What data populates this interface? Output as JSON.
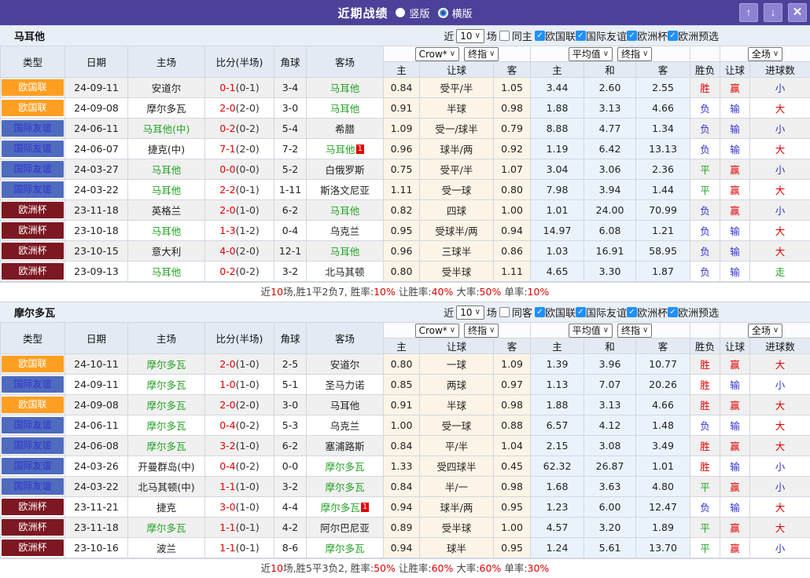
{
  "titlebar": {
    "title": "近期战绩",
    "vertical_label": "竖版",
    "horizontal_label": "横版"
  },
  "icons": {
    "check": "✓",
    "chevron": "∨",
    "up": "↑",
    "down": "↓",
    "close": "✕"
  },
  "colors": {
    "accent_purple": "#4c4199",
    "league_orange": "#ff9f22",
    "league_blue": "#4f6bbe",
    "league_maroon": "#7c1822",
    "win_red": "#e10000",
    "draw_green": "#23a223",
    "lose_blue": "#3232d0",
    "team_green": "#23a223",
    "checkbox_blue": "#1e90ff"
  },
  "table_labels": {
    "col_type": "类型",
    "col_date": "日期",
    "col_home": "主场",
    "col_score": "比分(半场)",
    "col_corner": "角球",
    "col_away": "客场",
    "sub_home": "主",
    "sub_handicap": "让球",
    "sub_away": "客",
    "sub_avg_home": "主",
    "sub_avg_draw": "和",
    "sub_avg_away": "客",
    "col_result": "胜负",
    "col_hcp_result": "让球",
    "col_goals": "进球数",
    "select_bookmaker": "Crow*",
    "select_final": "终指",
    "select_average": "平均值",
    "select_final2": "终指",
    "select_scope": "全场"
  },
  "sections": [
    {
      "team": "马耳他",
      "filter": {
        "near_label": "近",
        "count": "10",
        "games_label": "场",
        "same_label": "同主",
        "leagues": [
          "欧国联",
          "国际友谊",
          "欧洲杯",
          "欧洲预选"
        ]
      },
      "rows": [
        {
          "league": "欧国联",
          "league_color": "orange",
          "date": "24-09-11",
          "home": "安道尔",
          "home_color": "",
          "home_badge": "",
          "score": "0-1",
          "half": "(0-1)",
          "corner": "3-4",
          "away": "马耳他",
          "away_color": "green",
          "away_badge": "",
          "odds_home": "0.84",
          "handicap": "受平/半",
          "odds_away": "1.05",
          "avg_home": "3.44",
          "avg_draw": "2.60",
          "avg_away": "2.55",
          "result": "胜",
          "result_color": "red",
          "hcp_result": "赢",
          "hcp_result_color": "red",
          "goals": "小",
          "goals_color": "blue"
        },
        {
          "league": "欧国联",
          "league_color": "orange",
          "date": "24-09-08",
          "home": "摩尔多瓦",
          "home_color": "",
          "home_badge": "",
          "score": "2-0",
          "half": "(2-0)",
          "corner": "3-0",
          "away": "马耳他",
          "away_color": "green",
          "away_badge": "",
          "odds_home": "0.91",
          "handicap": "半球",
          "odds_away": "0.98",
          "avg_home": "1.88",
          "avg_draw": "3.13",
          "avg_away": "4.66",
          "result": "负",
          "result_color": "blue",
          "hcp_result": "输",
          "hcp_result_color": "blue",
          "goals": "大",
          "goals_color": "red"
        },
        {
          "league": "国际友谊",
          "league_color": "blue",
          "date": "24-06-11",
          "home": "马耳他(中)",
          "home_color": "green",
          "home_badge": "",
          "score": "0-2",
          "half": "(0-2)",
          "corner": "5-4",
          "away": "希腊",
          "away_color": "",
          "away_badge": "",
          "odds_home": "1.09",
          "handicap": "受一/球半",
          "odds_away": "0.79",
          "avg_home": "8.88",
          "avg_draw": "4.77",
          "avg_away": "1.34",
          "result": "负",
          "result_color": "blue",
          "hcp_result": "输",
          "hcp_result_color": "blue",
          "goals": "小",
          "goals_color": "blue"
        },
        {
          "league": "国际友谊",
          "league_color": "blue",
          "date": "24-06-07",
          "home": "捷克(中)",
          "home_color": "",
          "home_badge": "",
          "score": "7-1",
          "half": "(2-0)",
          "corner": "7-2",
          "away": "马耳他",
          "away_color": "green",
          "away_badge": "1",
          "odds_home": "0.96",
          "handicap": "球半/两",
          "odds_away": "0.92",
          "avg_home": "1.19",
          "avg_draw": "6.42",
          "avg_away": "13.13",
          "result": "负",
          "result_color": "blue",
          "hcp_result": "输",
          "hcp_result_color": "blue",
          "goals": "大",
          "goals_color": "red"
        },
        {
          "league": "国际友谊",
          "league_color": "blue",
          "date": "24-03-27",
          "home": "马耳他",
          "home_color": "green",
          "home_badge": "",
          "score": "0-0",
          "half": "(0-0)",
          "corner": "5-2",
          "away": "白俄罗斯",
          "away_color": "",
          "away_badge": "",
          "odds_home": "0.75",
          "handicap": "受平/半",
          "odds_away": "1.07",
          "avg_home": "3.04",
          "avg_draw": "3.06",
          "avg_away": "2.36",
          "result": "平",
          "result_color": "green",
          "hcp_result": "赢",
          "hcp_result_color": "red",
          "goals": "小",
          "goals_color": "blue"
        },
        {
          "league": "国际友谊",
          "league_color": "blue",
          "date": "24-03-22",
          "home": "马耳他",
          "home_color": "green",
          "home_badge": "",
          "score": "2-2",
          "half": "(0-1)",
          "corner": "1-11",
          "away": "斯洛文尼亚",
          "away_color": "",
          "away_badge": "",
          "odds_home": "1.11",
          "handicap": "受一球",
          "odds_away": "0.80",
          "avg_home": "7.98",
          "avg_draw": "3.94",
          "avg_away": "1.44",
          "result": "平",
          "result_color": "green",
          "hcp_result": "赢",
          "hcp_result_color": "red",
          "goals": "大",
          "goals_color": "red"
        },
        {
          "league": "欧洲杯",
          "league_color": "maroon",
          "date": "23-11-18",
          "home": "英格兰",
          "home_color": "",
          "home_badge": "",
          "score": "2-0",
          "half": "(1-0)",
          "corner": "6-2",
          "away": "马耳他",
          "away_color": "green",
          "away_badge": "",
          "odds_home": "0.82",
          "handicap": "四球",
          "odds_away": "1.00",
          "avg_home": "1.01",
          "avg_draw": "24.00",
          "avg_away": "70.99",
          "result": "负",
          "result_color": "blue",
          "hcp_result": "赢",
          "hcp_result_color": "red",
          "goals": "小",
          "goals_color": "blue"
        },
        {
          "league": "欧洲杯",
          "league_color": "maroon",
          "date": "23-10-18",
          "home": "马耳他",
          "home_color": "green",
          "home_badge": "",
          "score": "1-3",
          "half": "(1-2)",
          "corner": "0-4",
          "away": "乌克兰",
          "away_color": "",
          "away_badge": "",
          "odds_home": "0.95",
          "handicap": "受球半/两",
          "odds_away": "0.94",
          "avg_home": "14.97",
          "avg_draw": "6.08",
          "avg_away": "1.21",
          "result": "负",
          "result_color": "blue",
          "hcp_result": "输",
          "hcp_result_color": "blue",
          "goals": "大",
          "goals_color": "red"
        },
        {
          "league": "欧洲杯",
          "league_color": "maroon",
          "date": "23-10-15",
          "home": "意大利",
          "home_color": "",
          "home_badge": "",
          "score": "4-0",
          "half": "(2-0)",
          "corner": "12-1",
          "away": "马耳他",
          "away_color": "green",
          "away_badge": "",
          "odds_home": "0.96",
          "handicap": "三球半",
          "odds_away": "0.86",
          "avg_home": "1.03",
          "avg_draw": "16.91",
          "avg_away": "58.95",
          "result": "负",
          "result_color": "blue",
          "hcp_result": "输",
          "hcp_result_color": "blue",
          "goals": "大",
          "goals_color": "red"
        },
        {
          "league": "欧洲杯",
          "league_color": "maroon",
          "date": "23-09-13",
          "home": "马耳他",
          "home_color": "green",
          "home_badge": "",
          "score": "0-2",
          "half": "(0-2)",
          "corner": "3-2",
          "away": "北马其顿",
          "away_color": "",
          "away_badge": "",
          "odds_home": "0.80",
          "handicap": "受半球",
          "odds_away": "1.11",
          "avg_home": "4.65",
          "avg_draw": "3.30",
          "avg_away": "1.87",
          "result": "负",
          "result_color": "blue",
          "hcp_result": "输",
          "hcp_result_color": "blue",
          "goals": "走",
          "goals_color": "green"
        }
      ],
      "summary": [
        {
          "text": "近",
          "cls": ""
        },
        {
          "text": "10",
          "cls": "red"
        },
        {
          "text": "场,胜1平2负7, 胜率:",
          "cls": ""
        },
        {
          "text": "10%",
          "cls": "red"
        },
        {
          "text": " 让胜率:",
          "cls": ""
        },
        {
          "text": "40%",
          "cls": "red"
        },
        {
          "text": " 大率:",
          "cls": ""
        },
        {
          "text": "50%",
          "cls": "red"
        },
        {
          "text": " 单率:",
          "cls": ""
        },
        {
          "text": "10%",
          "cls": "red"
        }
      ]
    },
    {
      "team": "摩尔多瓦",
      "filter": {
        "near_label": "近",
        "count": "10",
        "games_label": "场",
        "same_label": "同客",
        "leagues": [
          "欧国联",
          "国际友谊",
          "欧洲杯",
          "欧洲预选"
        ]
      },
      "rows": [
        {
          "league": "欧国联",
          "league_color": "orange",
          "date": "24-10-11",
          "home": "摩尔多瓦",
          "home_color": "green",
          "home_badge": "",
          "score": "2-0",
          "half": "(1-0)",
          "corner": "2-5",
          "away": "安道尔",
          "away_color": "",
          "away_badge": "",
          "odds_home": "0.80",
          "handicap": "一球",
          "odds_away": "1.09",
          "avg_home": "1.39",
          "avg_draw": "3.96",
          "avg_away": "10.77",
          "result": "胜",
          "result_color": "red",
          "hcp_result": "赢",
          "hcp_result_color": "red",
          "goals": "大",
          "goals_color": "red"
        },
        {
          "league": "国际友谊",
          "league_color": "blue",
          "date": "24-09-11",
          "home": "摩尔多瓦",
          "home_color": "green",
          "home_badge": "",
          "score": "1-0",
          "half": "(1-0)",
          "corner": "5-1",
          "away": "圣马力诺",
          "away_color": "",
          "away_badge": "",
          "odds_home": "0.85",
          "handicap": "两球",
          "odds_away": "0.97",
          "avg_home": "1.13",
          "avg_draw": "7.07",
          "avg_away": "20.26",
          "result": "胜",
          "result_color": "red",
          "hcp_result": "输",
          "hcp_result_color": "blue",
          "goals": "小",
          "goals_color": "blue"
        },
        {
          "league": "欧国联",
          "league_color": "orange",
          "date": "24-09-08",
          "home": "摩尔多瓦",
          "home_color": "green",
          "home_badge": "",
          "score": "2-0",
          "half": "(2-0)",
          "corner": "3-0",
          "away": "马耳他",
          "away_color": "",
          "away_badge": "",
          "odds_home": "0.91",
          "handicap": "半球",
          "odds_away": "0.98",
          "avg_home": "1.88",
          "avg_draw": "3.13",
          "avg_away": "4.66",
          "result": "胜",
          "result_color": "red",
          "hcp_result": "赢",
          "hcp_result_color": "red",
          "goals": "大",
          "goals_color": "red"
        },
        {
          "league": "国际友谊",
          "league_color": "blue",
          "date": "24-06-11",
          "home": "摩尔多瓦",
          "home_color": "green",
          "home_badge": "",
          "score": "0-4",
          "half": "(0-2)",
          "corner": "5-3",
          "away": "乌克兰",
          "away_color": "",
          "away_badge": "",
          "odds_home": "1.00",
          "handicap": "受一球",
          "odds_away": "0.88",
          "avg_home": "6.57",
          "avg_draw": "4.12",
          "avg_away": "1.48",
          "result": "负",
          "result_color": "blue",
          "hcp_result": "输",
          "hcp_result_color": "blue",
          "goals": "大",
          "goals_color": "red"
        },
        {
          "league": "国际友谊",
          "league_color": "blue",
          "date": "24-06-08",
          "home": "摩尔多瓦",
          "home_color": "green",
          "home_badge": "",
          "score": "3-2",
          "half": "(1-0)",
          "corner": "6-2",
          "away": "塞浦路斯",
          "away_color": "",
          "away_badge": "",
          "odds_home": "0.84",
          "handicap": "平/半",
          "odds_away": "1.04",
          "avg_home": "2.15",
          "avg_draw": "3.08",
          "avg_away": "3.49",
          "result": "胜",
          "result_color": "red",
          "hcp_result": "赢",
          "hcp_result_color": "red",
          "goals": "大",
          "goals_color": "red"
        },
        {
          "league": "国际友谊",
          "league_color": "blue",
          "date": "24-03-26",
          "home": "开曼群岛(中)",
          "home_color": "",
          "home_badge": "",
          "score": "0-4",
          "half": "(0-2)",
          "corner": "0-0",
          "away": "摩尔多瓦",
          "away_color": "green",
          "away_badge": "",
          "odds_home": "1.33",
          "handicap": "受四球半",
          "odds_away": "0.45",
          "avg_home": "62.32",
          "avg_draw": "26.87",
          "avg_away": "1.01",
          "result": "胜",
          "result_color": "red",
          "hcp_result": "输",
          "hcp_result_color": "blue",
          "goals": "小",
          "goals_color": "blue"
        },
        {
          "league": "国际友谊",
          "league_color": "blue",
          "date": "24-03-22",
          "home": "北马其顿(中)",
          "home_color": "",
          "home_badge": "",
          "score": "1-1",
          "half": "(1-0)",
          "corner": "3-2",
          "away": "摩尔多瓦",
          "away_color": "green",
          "away_badge": "",
          "odds_home": "0.84",
          "handicap": "半/一",
          "odds_away": "0.98",
          "avg_home": "1.68",
          "avg_draw": "3.63",
          "avg_away": "4.80",
          "result": "平",
          "result_color": "green",
          "hcp_result": "赢",
          "hcp_result_color": "red",
          "goals": "小",
          "goals_color": "blue"
        },
        {
          "league": "欧洲杯",
          "league_color": "maroon",
          "date": "23-11-21",
          "home": "捷克",
          "home_color": "",
          "home_badge": "",
          "score": "3-0",
          "half": "(1-0)",
          "corner": "4-4",
          "away": "摩尔多瓦",
          "away_color": "green",
          "away_badge": "1",
          "odds_home": "0.94",
          "handicap": "球半/两",
          "odds_away": "0.95",
          "avg_home": "1.23",
          "avg_draw": "6.00",
          "avg_away": "12.47",
          "result": "负",
          "result_color": "blue",
          "hcp_result": "输",
          "hcp_result_color": "blue",
          "goals": "大",
          "goals_color": "red"
        },
        {
          "league": "欧洲杯",
          "league_color": "maroon",
          "date": "23-11-18",
          "home": "摩尔多瓦",
          "home_color": "green",
          "home_badge": "",
          "score": "1-1",
          "half": "(0-1)",
          "corner": "4-2",
          "away": "阿尔巴尼亚",
          "away_color": "",
          "away_badge": "",
          "odds_home": "0.89",
          "handicap": "受半球",
          "odds_away": "1.00",
          "avg_home": "4.57",
          "avg_draw": "3.20",
          "avg_away": "1.89",
          "result": "平",
          "result_color": "green",
          "hcp_result": "赢",
          "hcp_result_color": "red",
          "goals": "大",
          "goals_color": "red"
        },
        {
          "league": "欧洲杯",
          "league_color": "maroon",
          "date": "23-10-16",
          "home": "波兰",
          "home_color": "",
          "home_badge": "",
          "score": "1-1",
          "half": "(0-1)",
          "corner": "8-6",
          "away": "摩尔多瓦",
          "away_color": "green",
          "away_badge": "",
          "odds_home": "0.94",
          "handicap": "球半",
          "odds_away": "0.95",
          "avg_home": "1.24",
          "avg_draw": "5.61",
          "avg_away": "13.70",
          "result": "平",
          "result_color": "green",
          "hcp_result": "赢",
          "hcp_result_color": "red",
          "goals": "小",
          "goals_color": "blue"
        }
      ],
      "summary": [
        {
          "text": "近",
          "cls": ""
        },
        {
          "text": "10",
          "cls": "red"
        },
        {
          "text": "场,胜5平3负2, 胜率:",
          "cls": ""
        },
        {
          "text": "50%",
          "cls": "red"
        },
        {
          "text": " 让胜率:",
          "cls": ""
        },
        {
          "text": "60%",
          "cls": "red"
        },
        {
          "text": " 大率:",
          "cls": ""
        },
        {
          "text": "60%",
          "cls": "red"
        },
        {
          "text": " 单率:",
          "cls": ""
        },
        {
          "text": "30%",
          "cls": "red"
        }
      ]
    }
  ]
}
